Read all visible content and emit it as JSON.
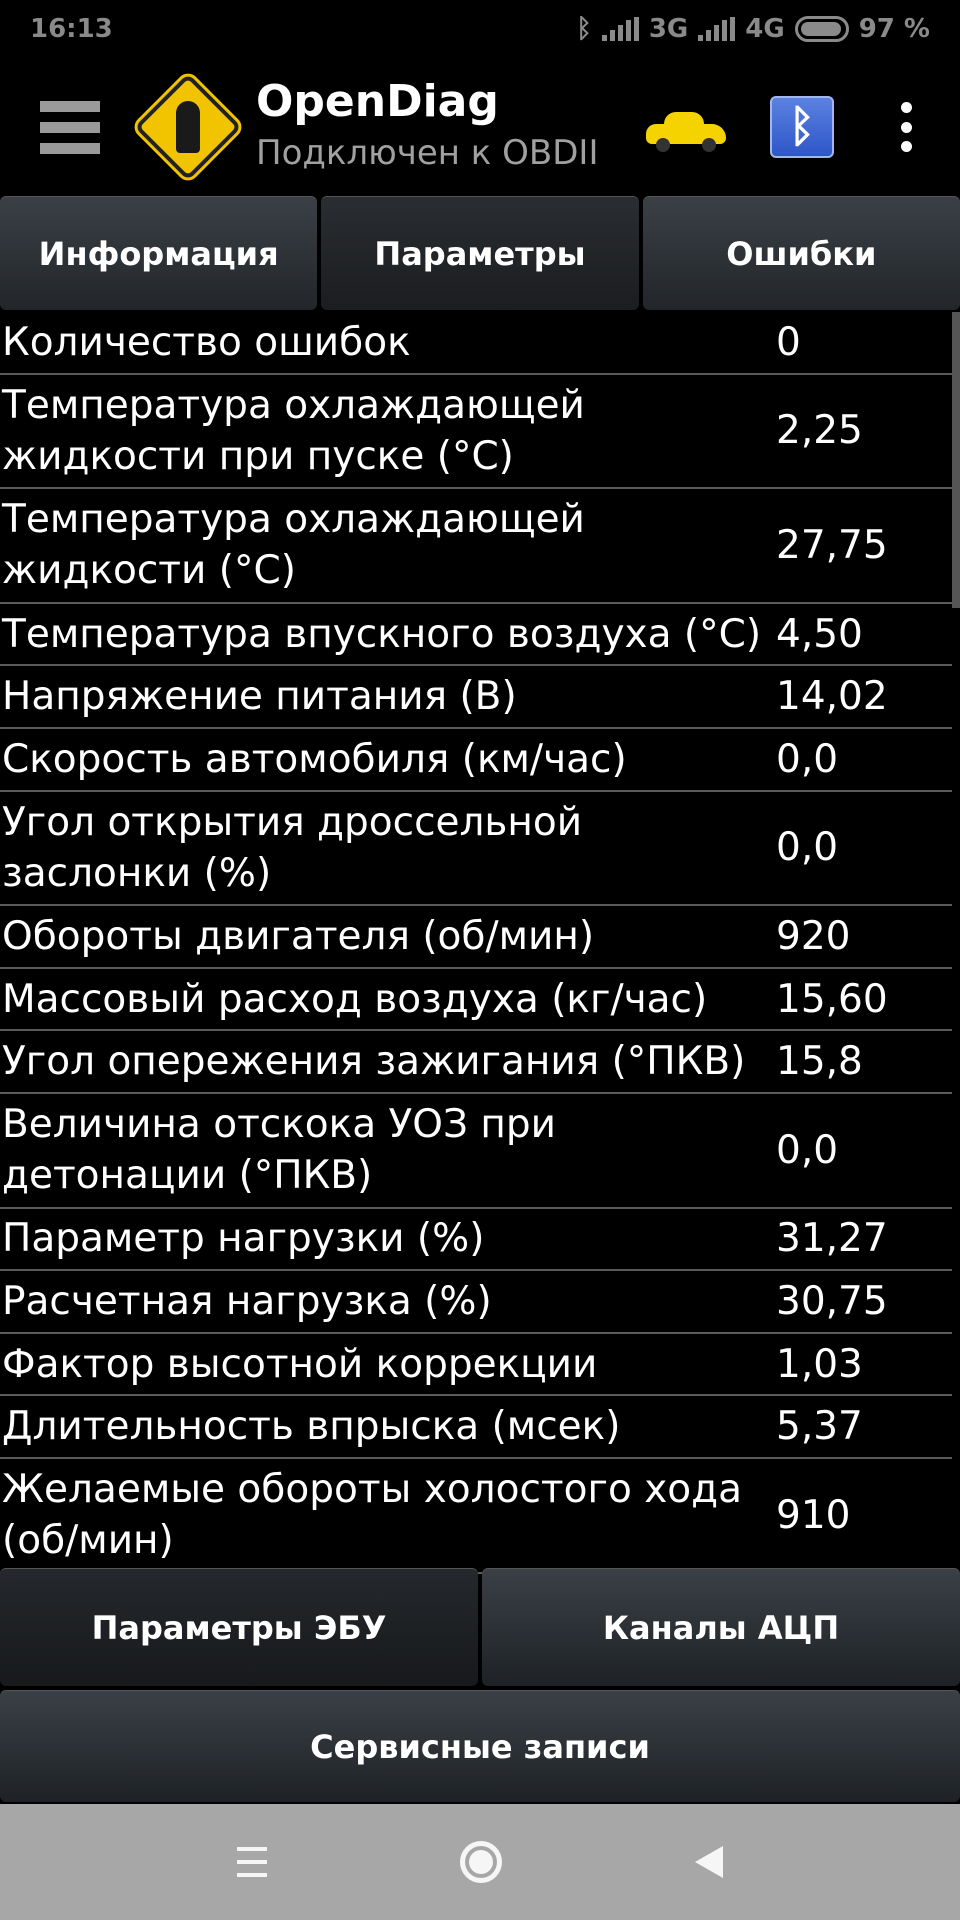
{
  "status_bar": {
    "time": "16:13",
    "network_1": "3G",
    "network_2": "4G",
    "battery": "97 %",
    "battery_level": 0.97
  },
  "app_bar": {
    "title": "OpenDiag",
    "subtitle": "Подключен к OBDII",
    "icons": [
      "menu-icon",
      "app-logo-key-icon",
      "car-icon",
      "bluetooth-icon",
      "more-vert-icon"
    ]
  },
  "tabs": [
    {
      "label": "Информация",
      "active": false
    },
    {
      "label": "Параметры",
      "active": true
    },
    {
      "label": "Ошибки",
      "active": false
    }
  ],
  "parameters": [
    {
      "name": "Количество ошибок",
      "value": "0"
    },
    {
      "name": "Температура охлаждающей жидкости при пуске (°С)",
      "value": "2,25"
    },
    {
      "name": "Температура охлаждающей жидкости (°С)",
      "value": "27,75"
    },
    {
      "name": "Температура впускного воздуха (°С)",
      "value": "4,50"
    },
    {
      "name": "Напряжение питания (В)",
      "value": "14,02"
    },
    {
      "name": "Скорость автомобиля (км/час)",
      "value": "0,0"
    },
    {
      "name": "Угол открытия дроссельной заслонки (%)",
      "value": "0,0"
    },
    {
      "name": "Обороты двигателя (об/мин)",
      "value": "920"
    },
    {
      "name": "Массовый расход воздуха (кг/час)",
      "value": "15,60"
    },
    {
      "name": "Угол опережения зажигания (°ПКВ)",
      "value": "15,8"
    },
    {
      "name": "Величина отскока УОЗ при детонации (°ПКВ)",
      "value": "0,0"
    },
    {
      "name": "Параметр нагрузки (%)",
      "value": "31,27"
    },
    {
      "name": "Расчетная нагрузка (%)",
      "value": "30,75"
    },
    {
      "name": "Фактор высотной коррекции",
      "value": "1,03"
    },
    {
      "name": "Длительность впрыска (мсек)",
      "value": "5,37"
    },
    {
      "name": "Желаемые обороты холостого хода (об/мин)",
      "value": "910"
    }
  ],
  "bottom_buttons": {
    "ecu_params": "Параметры ЭБУ",
    "adc_channels": "Каналы АЦП",
    "service_records": "Сервисные записи"
  },
  "colors": {
    "background": "#000000",
    "logo_yellow": "#f2c400",
    "bluetooth_blue": "#2e56c8",
    "nav_bar": "#a7a7a7"
  }
}
